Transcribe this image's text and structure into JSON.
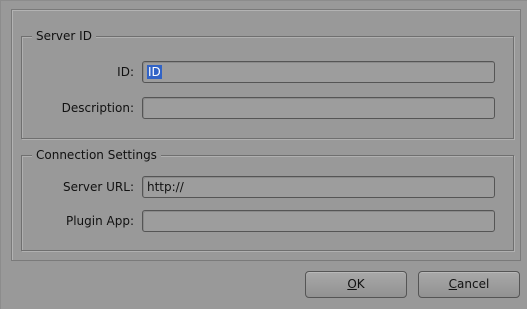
{
  "server_id": {
    "title": "Server ID",
    "id_label": "ID:",
    "id_value": "ID",
    "description_label": "Description:",
    "description_value": ""
  },
  "connection": {
    "title": "Connection Settings",
    "url_label": "Server URL:",
    "url_value": "http://",
    "plugin_label": "Plugin App:",
    "plugin_value": ""
  },
  "buttons": {
    "ok_mnemonic": "O",
    "ok_rest": "K",
    "cancel_mnemonic": "C",
    "cancel_rest": "ancel"
  }
}
